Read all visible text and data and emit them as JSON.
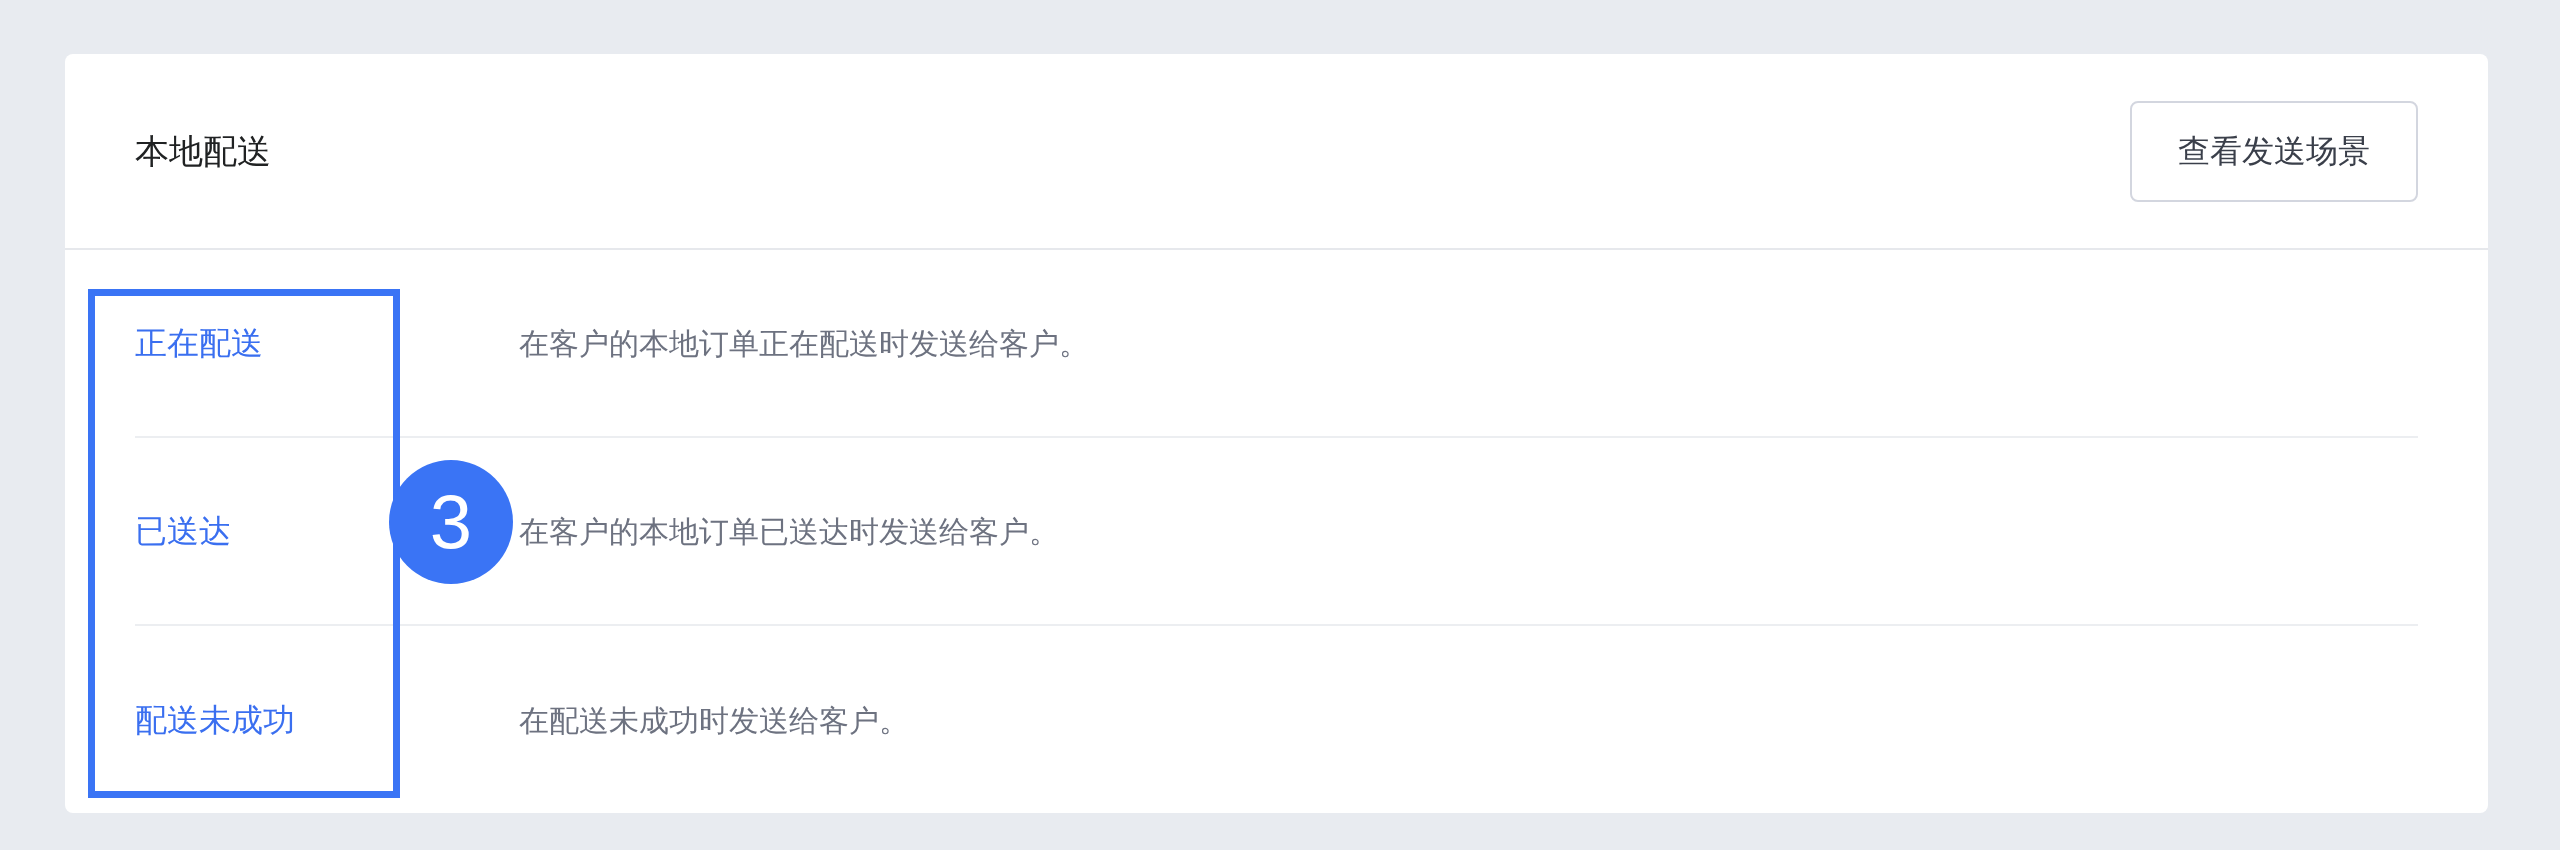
{
  "section": {
    "title": "本地配送",
    "button": "查看发送场景"
  },
  "notifications": [
    {
      "label": "正在配送",
      "description": "在客户的本地订单正在配送时发送给客户。"
    },
    {
      "label": "已送达",
      "description": "在客户的本地订单已送达时发送给客户。"
    },
    {
      "label": "配送未成功",
      "description": "在配送未成功时发送给客户。"
    }
  ],
  "annotation": {
    "number": "3"
  }
}
